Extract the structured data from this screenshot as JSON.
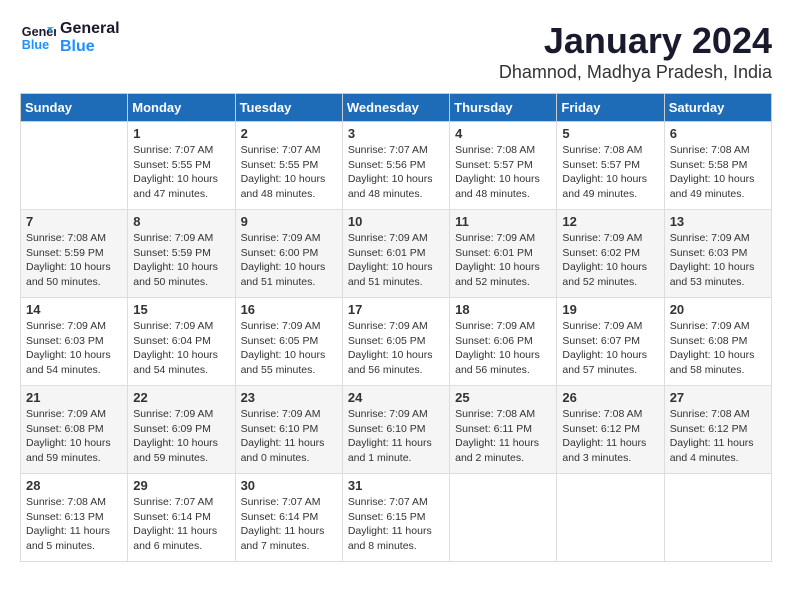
{
  "logo": {
    "line1": "General",
    "line2": "Blue"
  },
  "title": "January 2024",
  "subtitle": "Dhamnod, Madhya Pradesh, India",
  "days": [
    "Sunday",
    "Monday",
    "Tuesday",
    "Wednesday",
    "Thursday",
    "Friday",
    "Saturday"
  ],
  "weeks": [
    [
      {
        "num": "",
        "text": ""
      },
      {
        "num": "1",
        "text": "Sunrise: 7:07 AM\nSunset: 5:55 PM\nDaylight: 10 hours\nand 47 minutes."
      },
      {
        "num": "2",
        "text": "Sunrise: 7:07 AM\nSunset: 5:55 PM\nDaylight: 10 hours\nand 48 minutes."
      },
      {
        "num": "3",
        "text": "Sunrise: 7:07 AM\nSunset: 5:56 PM\nDaylight: 10 hours\nand 48 minutes."
      },
      {
        "num": "4",
        "text": "Sunrise: 7:08 AM\nSunset: 5:57 PM\nDaylight: 10 hours\nand 48 minutes."
      },
      {
        "num": "5",
        "text": "Sunrise: 7:08 AM\nSunset: 5:57 PM\nDaylight: 10 hours\nand 49 minutes."
      },
      {
        "num": "6",
        "text": "Sunrise: 7:08 AM\nSunset: 5:58 PM\nDaylight: 10 hours\nand 49 minutes."
      }
    ],
    [
      {
        "num": "7",
        "text": "Sunrise: 7:08 AM\nSunset: 5:59 PM\nDaylight: 10 hours\nand 50 minutes."
      },
      {
        "num": "8",
        "text": "Sunrise: 7:09 AM\nSunset: 5:59 PM\nDaylight: 10 hours\nand 50 minutes."
      },
      {
        "num": "9",
        "text": "Sunrise: 7:09 AM\nSunset: 6:00 PM\nDaylight: 10 hours\nand 51 minutes."
      },
      {
        "num": "10",
        "text": "Sunrise: 7:09 AM\nSunset: 6:01 PM\nDaylight: 10 hours\nand 51 minutes."
      },
      {
        "num": "11",
        "text": "Sunrise: 7:09 AM\nSunset: 6:01 PM\nDaylight: 10 hours\nand 52 minutes."
      },
      {
        "num": "12",
        "text": "Sunrise: 7:09 AM\nSunset: 6:02 PM\nDaylight: 10 hours\nand 52 minutes."
      },
      {
        "num": "13",
        "text": "Sunrise: 7:09 AM\nSunset: 6:03 PM\nDaylight: 10 hours\nand 53 minutes."
      }
    ],
    [
      {
        "num": "14",
        "text": "Sunrise: 7:09 AM\nSunset: 6:03 PM\nDaylight: 10 hours\nand 54 minutes."
      },
      {
        "num": "15",
        "text": "Sunrise: 7:09 AM\nSunset: 6:04 PM\nDaylight: 10 hours\nand 54 minutes."
      },
      {
        "num": "16",
        "text": "Sunrise: 7:09 AM\nSunset: 6:05 PM\nDaylight: 10 hours\nand 55 minutes."
      },
      {
        "num": "17",
        "text": "Sunrise: 7:09 AM\nSunset: 6:05 PM\nDaylight: 10 hours\nand 56 minutes."
      },
      {
        "num": "18",
        "text": "Sunrise: 7:09 AM\nSunset: 6:06 PM\nDaylight: 10 hours\nand 56 minutes."
      },
      {
        "num": "19",
        "text": "Sunrise: 7:09 AM\nSunset: 6:07 PM\nDaylight: 10 hours\nand 57 minutes."
      },
      {
        "num": "20",
        "text": "Sunrise: 7:09 AM\nSunset: 6:08 PM\nDaylight: 10 hours\nand 58 minutes."
      }
    ],
    [
      {
        "num": "21",
        "text": "Sunrise: 7:09 AM\nSunset: 6:08 PM\nDaylight: 10 hours\nand 59 minutes."
      },
      {
        "num": "22",
        "text": "Sunrise: 7:09 AM\nSunset: 6:09 PM\nDaylight: 10 hours\nand 59 minutes."
      },
      {
        "num": "23",
        "text": "Sunrise: 7:09 AM\nSunset: 6:10 PM\nDaylight: 11 hours\nand 0 minutes."
      },
      {
        "num": "24",
        "text": "Sunrise: 7:09 AM\nSunset: 6:10 PM\nDaylight: 11 hours\nand 1 minute."
      },
      {
        "num": "25",
        "text": "Sunrise: 7:08 AM\nSunset: 6:11 PM\nDaylight: 11 hours\nand 2 minutes."
      },
      {
        "num": "26",
        "text": "Sunrise: 7:08 AM\nSunset: 6:12 PM\nDaylight: 11 hours\nand 3 minutes."
      },
      {
        "num": "27",
        "text": "Sunrise: 7:08 AM\nSunset: 6:12 PM\nDaylight: 11 hours\nand 4 minutes."
      }
    ],
    [
      {
        "num": "28",
        "text": "Sunrise: 7:08 AM\nSunset: 6:13 PM\nDaylight: 11 hours\nand 5 minutes."
      },
      {
        "num": "29",
        "text": "Sunrise: 7:07 AM\nSunset: 6:14 PM\nDaylight: 11 hours\nand 6 minutes."
      },
      {
        "num": "30",
        "text": "Sunrise: 7:07 AM\nSunset: 6:14 PM\nDaylight: 11 hours\nand 7 minutes."
      },
      {
        "num": "31",
        "text": "Sunrise: 7:07 AM\nSunset: 6:15 PM\nDaylight: 11 hours\nand 8 minutes."
      },
      {
        "num": "",
        "text": ""
      },
      {
        "num": "",
        "text": ""
      },
      {
        "num": "",
        "text": ""
      }
    ]
  ]
}
